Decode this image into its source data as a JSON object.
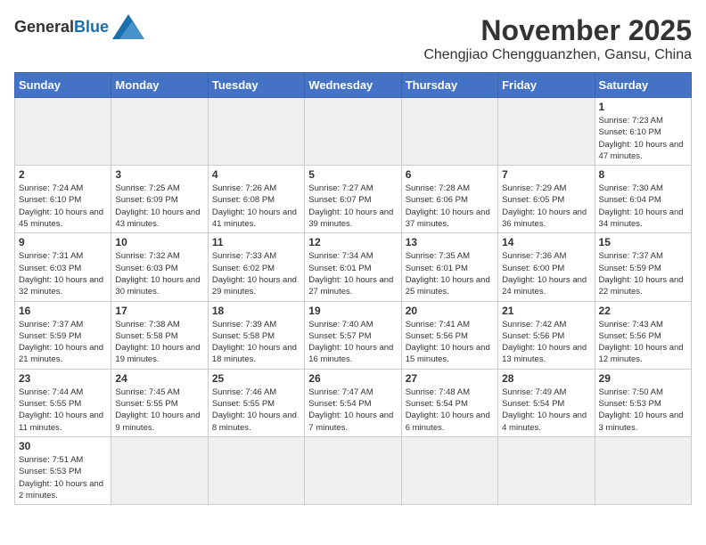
{
  "logo": {
    "text_general": "General",
    "text_blue": "Blue"
  },
  "title": {
    "month": "November 2025",
    "location": "Chengjiao Chengguanzhen, Gansu, China"
  },
  "weekdays": [
    "Sunday",
    "Monday",
    "Tuesday",
    "Wednesday",
    "Thursday",
    "Friday",
    "Saturday"
  ],
  "weeks": [
    [
      {
        "day": "",
        "info": ""
      },
      {
        "day": "",
        "info": ""
      },
      {
        "day": "",
        "info": ""
      },
      {
        "day": "",
        "info": ""
      },
      {
        "day": "",
        "info": ""
      },
      {
        "day": "",
        "info": ""
      },
      {
        "day": "1",
        "info": "Sunrise: 7:23 AM\nSunset: 6:10 PM\nDaylight: 10 hours and 47 minutes."
      }
    ],
    [
      {
        "day": "2",
        "info": "Sunrise: 7:24 AM\nSunset: 6:10 PM\nDaylight: 10 hours and 45 minutes."
      },
      {
        "day": "3",
        "info": "Sunrise: 7:25 AM\nSunset: 6:09 PM\nDaylight: 10 hours and 43 minutes."
      },
      {
        "day": "4",
        "info": "Sunrise: 7:26 AM\nSunset: 6:08 PM\nDaylight: 10 hours and 41 minutes."
      },
      {
        "day": "5",
        "info": "Sunrise: 7:27 AM\nSunset: 6:07 PM\nDaylight: 10 hours and 39 minutes."
      },
      {
        "day": "6",
        "info": "Sunrise: 7:28 AM\nSunset: 6:06 PM\nDaylight: 10 hours and 37 minutes."
      },
      {
        "day": "7",
        "info": "Sunrise: 7:29 AM\nSunset: 6:05 PM\nDaylight: 10 hours and 36 minutes."
      },
      {
        "day": "8",
        "info": "Sunrise: 7:30 AM\nSunset: 6:04 PM\nDaylight: 10 hours and 34 minutes."
      }
    ],
    [
      {
        "day": "9",
        "info": "Sunrise: 7:31 AM\nSunset: 6:03 PM\nDaylight: 10 hours and 32 minutes."
      },
      {
        "day": "10",
        "info": "Sunrise: 7:32 AM\nSunset: 6:03 PM\nDaylight: 10 hours and 30 minutes."
      },
      {
        "day": "11",
        "info": "Sunrise: 7:33 AM\nSunset: 6:02 PM\nDaylight: 10 hours and 29 minutes."
      },
      {
        "day": "12",
        "info": "Sunrise: 7:34 AM\nSunset: 6:01 PM\nDaylight: 10 hours and 27 minutes."
      },
      {
        "day": "13",
        "info": "Sunrise: 7:35 AM\nSunset: 6:01 PM\nDaylight: 10 hours and 25 minutes."
      },
      {
        "day": "14",
        "info": "Sunrise: 7:36 AM\nSunset: 6:00 PM\nDaylight: 10 hours and 24 minutes."
      },
      {
        "day": "15",
        "info": "Sunrise: 7:37 AM\nSunset: 5:59 PM\nDaylight: 10 hours and 22 minutes."
      }
    ],
    [
      {
        "day": "16",
        "info": "Sunrise: 7:37 AM\nSunset: 5:59 PM\nDaylight: 10 hours and 21 minutes."
      },
      {
        "day": "17",
        "info": "Sunrise: 7:38 AM\nSunset: 5:58 PM\nDaylight: 10 hours and 19 minutes."
      },
      {
        "day": "18",
        "info": "Sunrise: 7:39 AM\nSunset: 5:58 PM\nDaylight: 10 hours and 18 minutes."
      },
      {
        "day": "19",
        "info": "Sunrise: 7:40 AM\nSunset: 5:57 PM\nDaylight: 10 hours and 16 minutes."
      },
      {
        "day": "20",
        "info": "Sunrise: 7:41 AM\nSunset: 5:56 PM\nDaylight: 10 hours and 15 minutes."
      },
      {
        "day": "21",
        "info": "Sunrise: 7:42 AM\nSunset: 5:56 PM\nDaylight: 10 hours and 13 minutes."
      },
      {
        "day": "22",
        "info": "Sunrise: 7:43 AM\nSunset: 5:56 PM\nDaylight: 10 hours and 12 minutes."
      }
    ],
    [
      {
        "day": "23",
        "info": "Sunrise: 7:44 AM\nSunset: 5:55 PM\nDaylight: 10 hours and 11 minutes."
      },
      {
        "day": "24",
        "info": "Sunrise: 7:45 AM\nSunset: 5:55 PM\nDaylight: 10 hours and 9 minutes."
      },
      {
        "day": "25",
        "info": "Sunrise: 7:46 AM\nSunset: 5:55 PM\nDaylight: 10 hours and 8 minutes."
      },
      {
        "day": "26",
        "info": "Sunrise: 7:47 AM\nSunset: 5:54 PM\nDaylight: 10 hours and 7 minutes."
      },
      {
        "day": "27",
        "info": "Sunrise: 7:48 AM\nSunset: 5:54 PM\nDaylight: 10 hours and 6 minutes."
      },
      {
        "day": "28",
        "info": "Sunrise: 7:49 AM\nSunset: 5:54 PM\nDaylight: 10 hours and 4 minutes."
      },
      {
        "day": "29",
        "info": "Sunrise: 7:50 AM\nSunset: 5:53 PM\nDaylight: 10 hours and 3 minutes."
      }
    ],
    [
      {
        "day": "30",
        "info": "Sunrise: 7:51 AM\nSunset: 5:53 PM\nDaylight: 10 hours and 2 minutes."
      },
      {
        "day": "",
        "info": ""
      },
      {
        "day": "",
        "info": ""
      },
      {
        "day": "",
        "info": ""
      },
      {
        "day": "",
        "info": ""
      },
      {
        "day": "",
        "info": ""
      },
      {
        "day": "",
        "info": ""
      }
    ]
  ]
}
